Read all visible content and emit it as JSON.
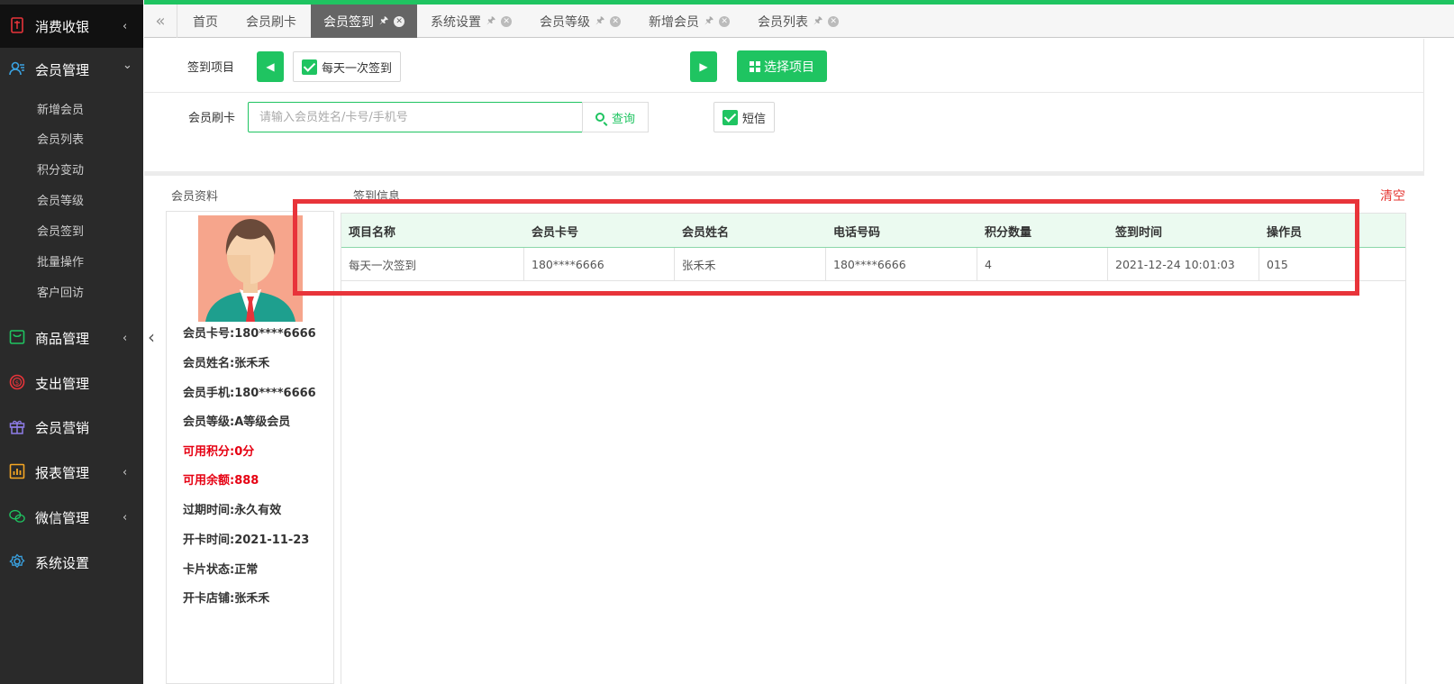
{
  "sidebar": {
    "groups": [
      {
        "label": "消费收银",
        "icon": "receipt-icon",
        "arrow": "‹"
      },
      {
        "label": "会员管理",
        "icon": "member-icon",
        "arrow": "⌄"
      },
      {
        "label": "商品管理",
        "icon": "goods-icon",
        "arrow": "‹"
      },
      {
        "label": "支出管理",
        "icon": "expense-icon",
        "arrow": ""
      },
      {
        "label": "会员营销",
        "icon": "gift-icon",
        "arrow": ""
      },
      {
        "label": "报表管理",
        "icon": "report-icon",
        "arrow": "‹"
      },
      {
        "label": "微信管理",
        "icon": "wechat-icon",
        "arrow": "‹"
      },
      {
        "label": "系统设置",
        "icon": "settings-icon",
        "arrow": ""
      }
    ],
    "member_sub_items": [
      "新增会员",
      "会员列表",
      "积分变动",
      "会员等级",
      "会员签到",
      "批量操作",
      "客户回访"
    ]
  },
  "tabs": [
    {
      "label": "首页",
      "active": false,
      "closable": false
    },
    {
      "label": "会员刷卡",
      "active": false,
      "closable": false
    },
    {
      "label": "会员签到",
      "active": true,
      "closable": true
    },
    {
      "label": "系统设置",
      "active": false,
      "closable": true
    },
    {
      "label": "会员等级",
      "active": false,
      "closable": true
    },
    {
      "label": "新增会员",
      "active": false,
      "closable": true
    },
    {
      "label": "会员列表",
      "active": false,
      "closable": true
    }
  ],
  "checkin": {
    "project_label": "签到项目",
    "project_option": "每天一次签到",
    "select_button": "选择项目",
    "card_label": "会员刷卡",
    "search_placeholder": "请输入会员姓名/卡号/手机号",
    "query_button": "查询",
    "sms_label": "短信"
  },
  "member": {
    "section_title": "会员资料",
    "card_no": "会员卡号:180****6666",
    "name": "会员姓名:张禾禾",
    "phone": "会员手机:180****6666",
    "level": "会员等级:A等级会员",
    "points": "可用积分:0分",
    "balance": "可用余额:888",
    "expire": "过期时间:永久有效",
    "open_date": "开卡时间:2021-11-23",
    "status": "卡片状态:正常",
    "store": "开卡店铺:张禾禾"
  },
  "signin_info": {
    "section_title": "签到信息",
    "clear_label": "清空",
    "columns": [
      "项目名称",
      "会员卡号",
      "会员姓名",
      "电话号码",
      "积分数量",
      "签到时间",
      "操作员"
    ],
    "rows": [
      [
        "每天一次签到",
        "180****6666",
        "张禾禾",
        "180****6666",
        "4",
        "2021-12-24 10:01:03",
        "015"
      ]
    ]
  },
  "colors": {
    "accent": "#1fc461",
    "highlight_box": "#e8343a",
    "warning_text": "#e60012"
  }
}
